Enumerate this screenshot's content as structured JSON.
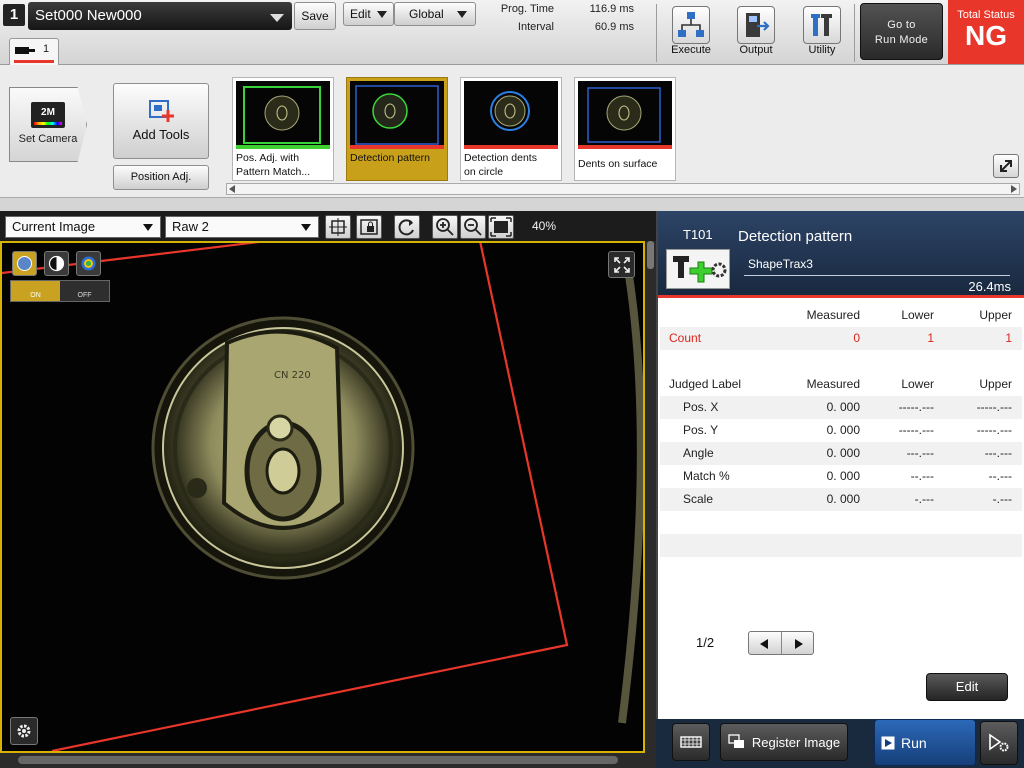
{
  "header": {
    "set_number": "1",
    "set_title": "Set000  New000",
    "save_label": "Save",
    "edit_label": "Edit",
    "global_label": "Global",
    "prog_time_label": "Prog. Time",
    "prog_time_value": "116.9 ms",
    "interval_label": "Interval",
    "interval_value": "60.9 ms",
    "execute_label": "Execute",
    "output_label": "Output",
    "utility_label": "Utility",
    "run_mode_line1": "Go to",
    "run_mode_line2": "Run Mode",
    "total_status_label": "Total Status",
    "total_status_value": "NG",
    "tab_label": "1"
  },
  "toolbar": {
    "set_camera_label": "Set Camera",
    "camera_badge": "2M",
    "add_tools_label": "Add Tools",
    "position_adj_label": "Position Adj.",
    "thumbnails": [
      {
        "line1": "Pos.  Adj.  with",
        "line2": "Pattern Match...",
        "status_color": "#3ccf2e"
      },
      {
        "line1": "Detection  pattern",
        "line2": "",
        "status_color": "#e8362a"
      },
      {
        "line1": "Detection  dents",
        "line2": "on  circle",
        "status_color": "#e8362a"
      },
      {
        "line1": "Dents  on  surface",
        "line2": "",
        "status_color": "#e8362a"
      }
    ]
  },
  "image_view": {
    "image_select": "Current Image",
    "raw_select": "Raw 2",
    "zoom": "40%",
    "overlay_on": "ON",
    "overlay_off": "OFF",
    "can_mark_text": "CN 220"
  },
  "tool_panel": {
    "tool_id": "T101",
    "tool_name": "Detection  pattern",
    "tool_type": "ShapeTrax3",
    "exec_time": "26.4ms",
    "count_header": {
      "measured": "Measured",
      "lower": "Lower",
      "upper": "Upper"
    },
    "count_row": {
      "label": "Count",
      "measured": "0",
      "lower": "1",
      "upper": "1"
    },
    "label_header": {
      "label": "Judged  Label",
      "measured": "Measured",
      "lower": "Lower",
      "upper": "Upper"
    },
    "rows": [
      {
        "label": "Pos.  X",
        "measured": "0. 000",
        "lower": "-----.---",
        "upper": "-----.---"
      },
      {
        "label": "Pos.  Y",
        "measured": "0. 000",
        "lower": "-----.---",
        "upper": "-----.---"
      },
      {
        "label": "Angle",
        "measured": "0. 000",
        "lower": "---.---",
        "upper": "---.---"
      },
      {
        "label": "Match  %",
        "measured": "0. 000",
        "lower": "--.---",
        "upper": "--.---"
      },
      {
        "label": "Scale",
        "measured": "0. 000",
        "lower": "-.---",
        "upper": "-.---"
      }
    ],
    "page": "1/2",
    "edit_label": "Edit"
  },
  "bottom_bar": {
    "register_image_label": "Register  Image",
    "run_label": "Run"
  },
  "colors": {
    "ng_red": "#e8362a",
    "selected_gold": "#c9a01a",
    "panel_navy": "#1e3350",
    "count_red": "#d9261c"
  }
}
